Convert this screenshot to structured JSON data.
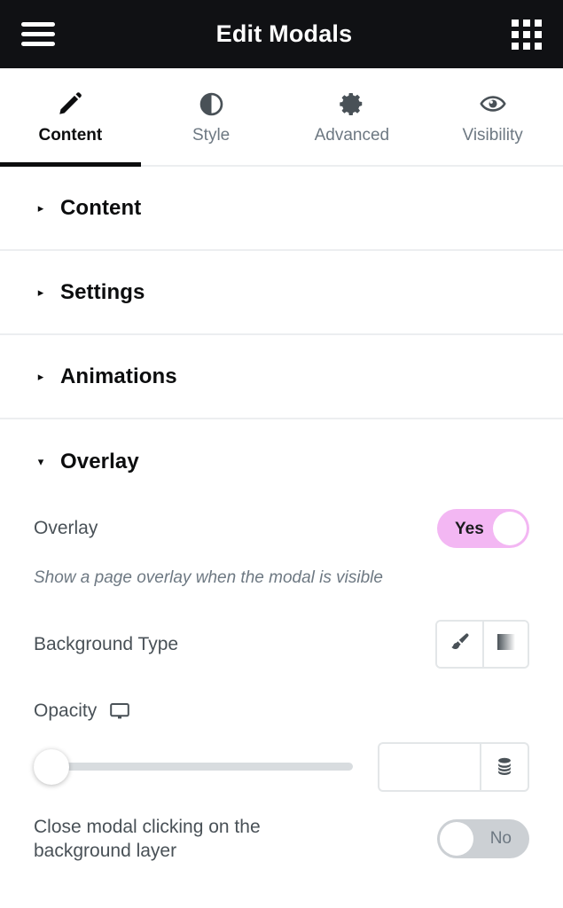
{
  "header": {
    "menu_icon": "hamburger-menu-icon",
    "title": "Edit Modals",
    "apps_icon": "apps-grid-icon"
  },
  "tabs": [
    {
      "label": "Content",
      "icon": "pencil-icon",
      "active": true
    },
    {
      "label": "Style",
      "icon": "contrast-icon",
      "active": false
    },
    {
      "label": "Advanced",
      "icon": "gear-icon",
      "active": false
    },
    {
      "label": "Visibility",
      "icon": "eye-icon",
      "active": false
    }
  ],
  "sections": [
    {
      "title": "Content",
      "expanded": false,
      "caret": "▸"
    },
    {
      "title": "Settings",
      "expanded": false,
      "caret": "▸"
    },
    {
      "title": "Animations",
      "expanded": false,
      "caret": "▸"
    },
    {
      "title": "Overlay",
      "expanded": true,
      "caret": "▾"
    }
  ],
  "overlay": {
    "overlay_toggle": {
      "label": "Overlay",
      "value": "Yes",
      "state": "on",
      "description": "Show a page overlay when the modal is visible"
    },
    "background_type": {
      "label": "Background Type",
      "options": [
        {
          "name": "classic",
          "icon": "paintbrush-icon"
        },
        {
          "name": "gradient",
          "icon": "gradient-icon"
        }
      ]
    },
    "opacity": {
      "label": "Opacity",
      "device_icon": "desktop-monitor-icon",
      "slider_value": 0,
      "slider_min": 0,
      "slider_max": 100,
      "input_value": "",
      "input_placeholder": "",
      "dynamic_icon": "database-stack-icon"
    },
    "close_on_background": {
      "label": "Close modal clicking on the background layer",
      "value": "No",
      "state": "off"
    }
  },
  "colors": {
    "topbar_bg": "#101114",
    "accent_on": "#f3b7f3",
    "switch_off": "#ccd0d4",
    "text_dark": "#0c0d0e",
    "text_muted": "#6d7882",
    "border": "#e3e6e8"
  }
}
